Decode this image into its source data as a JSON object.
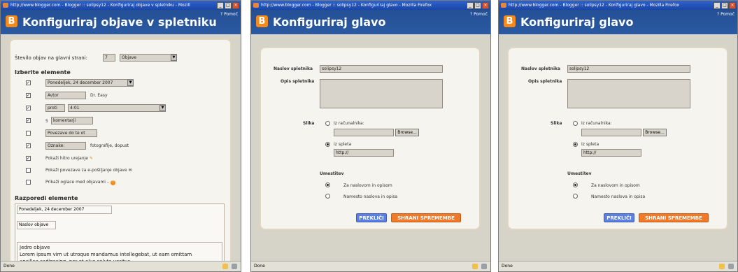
{
  "window1": {
    "titlebar": "http://www.blogger.com - Blogger :: solipsy12 - Konfiguriraj objave v spletniku - Mozill",
    "header_title": "Konfiguriraj objave v spletniku",
    "help": "? Pomoč",
    "posts_count_label": "Število objav na glavni strani:",
    "posts_count_value": "7",
    "posts_unit": "Objave",
    "select_section": "Izberite elemente",
    "date_value": "Ponedeljek, 24 december 2007",
    "author_label": "Avtor",
    "author_name": "Dr. Easy",
    "time_prefix": "proti",
    "time_value": "4:01",
    "comments_prefix": "5",
    "comments_label": "komentarji",
    "links_label": "Povezave do te ot",
    "tags_label": "Oznake:",
    "tags_value": "fotografije, dopust",
    "quick_edit": "Pokaži hitro urejanje",
    "email_links": "Pokaži povezave za e-pošiljanje objave",
    "show_ads": "Prikaži oglace med objavami –",
    "arrange_section": "Razporedi elemente",
    "arr_date": "Ponedeljek, 24 december 2007",
    "arr_title": "Naslov objave",
    "arr_body_title": "Jedro objave",
    "arr_body_text1": "Lorem ipsum vim ut utroque mandamus intellegebat, ut eam omittam",
    "arr_body_text2": "ancillae sadipscing, per et elus soluta veritus.",
    "status": "Done"
  },
  "window2": {
    "titlebar": "http://www.blogger.com - Blogger :: solipsy12 - Konfiguriraj glavo - Mozilla Firefox",
    "header_title": "Konfiguriraj glavo",
    "help": "? Pomoč",
    "blog_title_label": "Naslov spletnika",
    "blog_title_value": "solipsy12",
    "blog_desc_label": "Opis spletnika",
    "image_label": "Slika",
    "from_computer": "Iz računalnika:",
    "browse": "Browse...",
    "from_web": "Iz spleta",
    "url_value": "http://",
    "placement_label": "Umestitev",
    "behind_title": "Za naslovom in opisom",
    "instead_title": "Namesto naslova in opisa",
    "cancel": "PREKLIČI",
    "save": "SHRANI SPREMEMBE",
    "status": "Done"
  },
  "window3": {
    "titlebar": "http://www.blogger.com - Blogger :: solipsy12 - Konfiguriraj glavo - Mozilla Firefox",
    "header_title": "Konfiguriraj glavo",
    "help": "? Pomoč",
    "blog_title_label": "Naslov spletnika",
    "blog_title_value": "solipsy12",
    "blog_desc_label": "Opis spletnika",
    "image_label": "Slika",
    "from_computer": "Iz računalnika:",
    "browse": "Browse...",
    "from_web": "Iz spleta",
    "url_value": "http://",
    "placement_label": "Umestitev",
    "behind_title": "Za naslovom in opisom",
    "instead_title": "Namesto naslova in opisa",
    "cancel": "PREKLIČI",
    "save": "SHRANI SPREMEMBE",
    "status": "Done"
  },
  "colors": {
    "blogger_header": "#234f95",
    "blogger_orange": "#f28a1e",
    "cancel_button": "#5c7fe0",
    "save_button": "#f07a2a"
  },
  "icons": [
    "blogger-logo-icon",
    "pencil-icon",
    "email-icon",
    "help-icon"
  ]
}
